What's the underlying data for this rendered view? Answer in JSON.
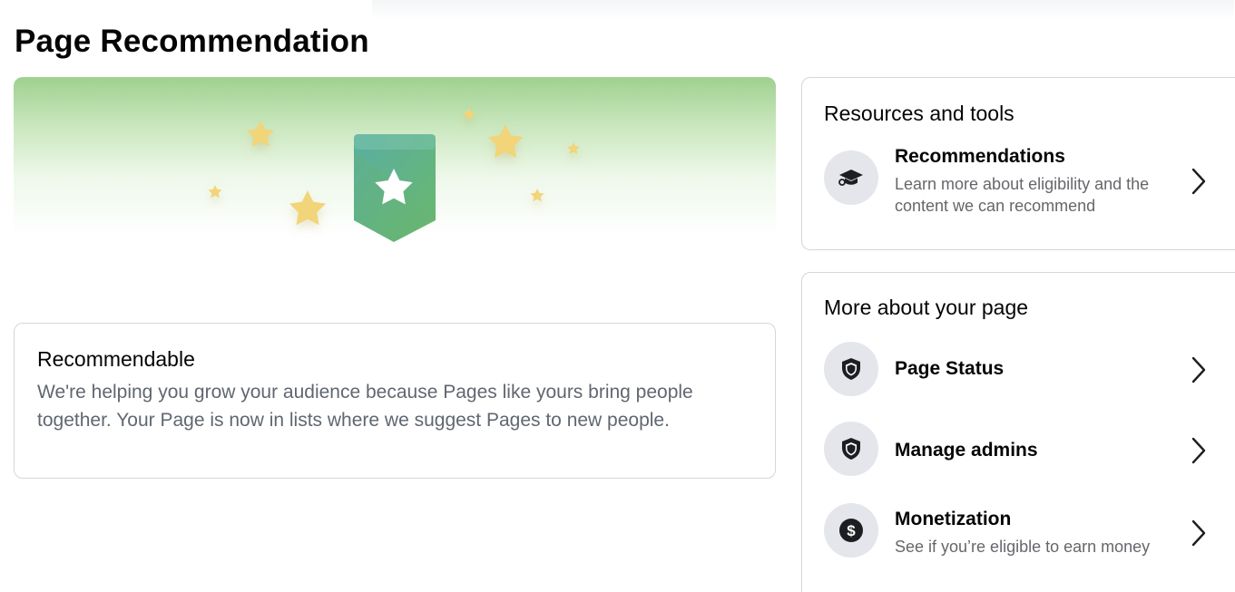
{
  "page": {
    "title": "Page Recommendation"
  },
  "status": {
    "title": "Recommendable",
    "description": "We're helping you grow your audience because Pages like yours bring people together. Your Page is now in lists where we suggest Pages to new people."
  },
  "resources": {
    "title": "Resources and tools",
    "items": [
      {
        "label": "Recommendations",
        "description": "Learn more about eligibility and the content we can recommend",
        "icon": "graduation-cap-icon"
      }
    ]
  },
  "more": {
    "title": "More about your page",
    "items": [
      {
        "label": "Page Status",
        "icon": "shield-icon"
      },
      {
        "label": "Manage admins",
        "icon": "shield-icon"
      },
      {
        "label": "Monetization",
        "description": "See if you’re eligible to earn money",
        "icon": "dollar-coin-icon"
      }
    ]
  },
  "colors": {
    "banner_green": "#9fd08f",
    "badge_teal": "#5fb3a0",
    "star_yellow": "#f2d479",
    "icon_bg": "#e4e6eb"
  }
}
